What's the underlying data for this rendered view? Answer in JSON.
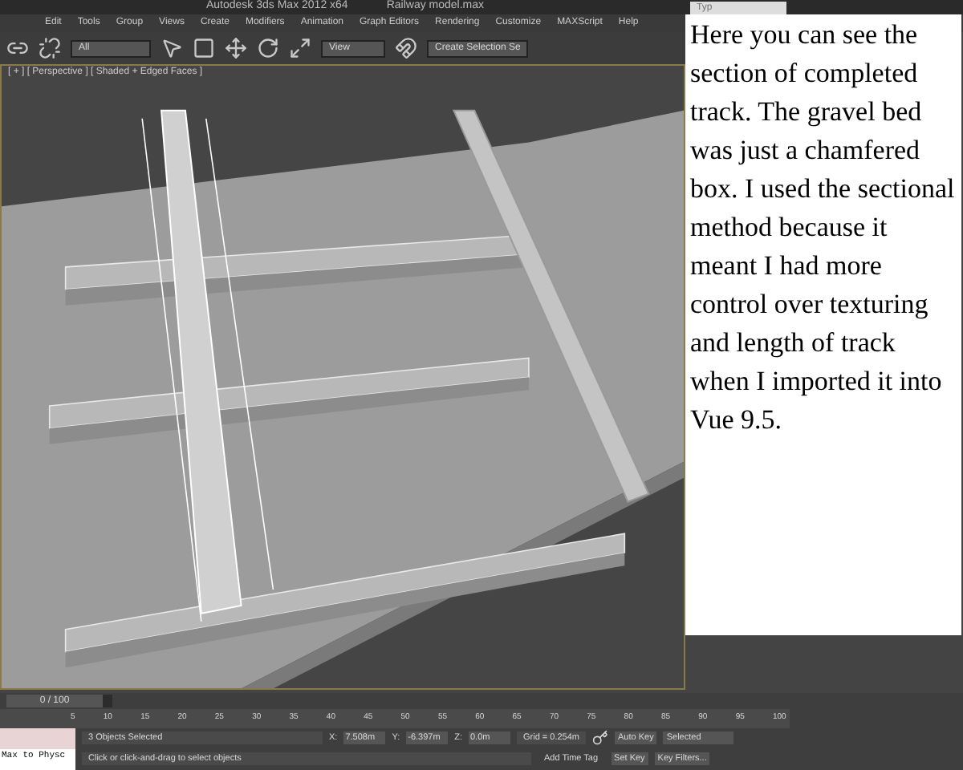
{
  "window": {
    "title": "Autodesk 3ds Max  2012 x64",
    "file": "Railway model.max",
    "search_placeholder": "Typ"
  },
  "menu": [
    "Edit",
    "Tools",
    "Group",
    "Views",
    "Create",
    "Modifiers",
    "Animation",
    "Graph Editors",
    "Rendering",
    "Customize",
    "MAXScript",
    "Help"
  ],
  "toolbar": {
    "filter": "All",
    "coordinate": "View",
    "selection_set": "Create Selection Se"
  },
  "viewport": {
    "label": "[ + ] [ Perspective ] [ Shaded + Edged Faces ]"
  },
  "note": "Here you can see the section of completed track. The gravel bed was just a chamfered box.  I used the sectional method because it meant I had more control over texturing and length of track when I imported it into Vue 9.5.",
  "time_slider": {
    "reading": "0 / 100",
    "level": 0
  },
  "ruler": [
    "5",
    "10",
    "15",
    "20",
    "25",
    "30",
    "35",
    "40",
    "45",
    "50",
    "55",
    "60",
    "65",
    "70",
    "75",
    "80",
    "85",
    "90",
    "95",
    "100"
  ],
  "status": {
    "script_listener": "Max to Physc",
    "selection": "3 Objects Selected",
    "prompt": "Click or click-and-drag to select objects",
    "x_label": "X:",
    "y_label": "Y:",
    "z_label": "Z:",
    "x": "7.508m",
    "y": "-6.397m",
    "z": "0.0m",
    "grid": "Grid = 0.254m",
    "add_time_tag": "Add Time Tag",
    "auto_key": "Auto Key",
    "set_key": "Set Key",
    "key_mode": "Selected",
    "key_filters": "Key Filters..."
  }
}
